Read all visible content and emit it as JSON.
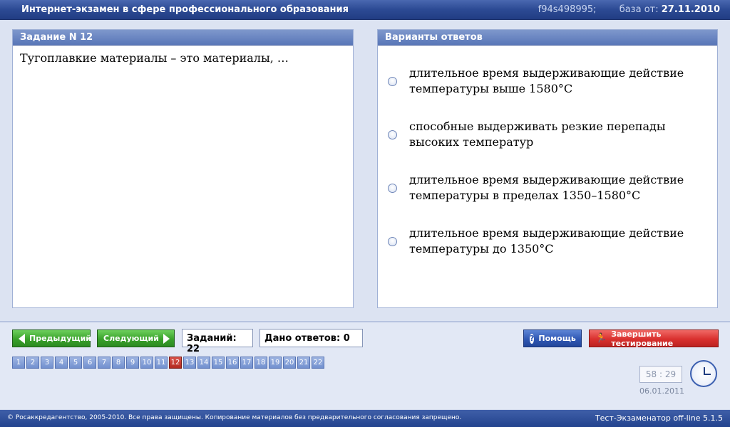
{
  "title_bar": {
    "title": "Интернет-экзамен в сфере профессионального образования",
    "code": "f94s498995;",
    "db_label": "база от:",
    "db_date": "27.11.2010"
  },
  "task_panel": {
    "header": "Задание N 12",
    "question": "Тугоплавкие материалы – это материалы, …"
  },
  "answers_panel": {
    "header": "Варианты ответов",
    "options": [
      "длительное время выдерживающие действие температуры выше 1580°C",
      "способные выдерживать резкие перепады высоких температур",
      "длительное время выдерживающие действие температуры в пределах 1350–1580°C",
      "длительное время выдерживающие действие температуры до 1350°C"
    ]
  },
  "nav": {
    "prev_label": "Предыдущий",
    "next_label": "Следующий",
    "tasks_count": "Заданий: 22",
    "answers_given": "Дано ответов: 0",
    "help_label": "Помощь",
    "finish_label": "Завершить тестирование"
  },
  "pages": {
    "items": [
      "1",
      "2",
      "3",
      "4",
      "5",
      "6",
      "7",
      "8",
      "9",
      "10",
      "11",
      "12",
      "13",
      "14",
      "15",
      "16",
      "17",
      "18",
      "19",
      "20",
      "21",
      "22"
    ],
    "active": "12"
  },
  "timer": "58 : 29",
  "date": "06.01.2011",
  "footer": {
    "copyright": "© Росаккредагентство, 2005-2010. Все права защищены. Копирование материалов без предварительного согласования запрещено.",
    "version": "Тест-Экзаменатор off-line 5.1.5"
  },
  "colors": {
    "accent": "#2c4a94",
    "active_page": "#b2291f",
    "nav_button": "#39a12a",
    "help_button": "#2f57b3",
    "finish_button": "#d9302e"
  },
  "icons": {
    "prev": "triangle-left-icon",
    "next": "triangle-right-icon",
    "help": "question-icon",
    "finish": "running-man-icon",
    "clock": "clock-icon"
  }
}
